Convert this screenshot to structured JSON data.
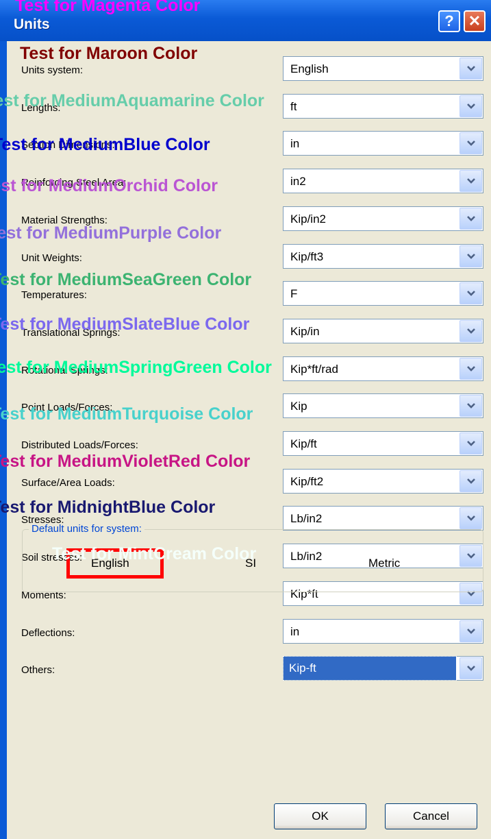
{
  "window": {
    "title": "Units",
    "help_glyph": "?",
    "close_glyph": "✕"
  },
  "rows": [
    {
      "label": "Units system:",
      "value": "English"
    },
    {
      "label": "Lengths:",
      "value": "ft"
    },
    {
      "label": "Section Dimensions:",
      "value": "in"
    },
    {
      "label": "Reinforcing Steel Area:",
      "value": "in2"
    },
    {
      "label": "Material Strengths:",
      "value": "Kip/in2"
    },
    {
      "label": "Unit Weights:",
      "value": "Kip/ft3"
    },
    {
      "label": "Temperatures:",
      "value": "F"
    },
    {
      "label": "Translational Springs:",
      "value": "Kip/in"
    },
    {
      "label": "Rotational Springs:",
      "value": "Kip*ft/rad"
    },
    {
      "label": "Point Loads/Forces:",
      "value": "Kip"
    },
    {
      "label": "Distributed Loads/Forces:",
      "value": "Kip/ft"
    },
    {
      "label": "Surface/Area Loads:",
      "value": "Kip/ft2"
    },
    {
      "label": "Stresses:",
      "value": "Lb/in2"
    },
    {
      "label": "Soil stresses:",
      "value": "Lb/in2"
    },
    {
      "label": "Moments:",
      "value": "Kip*ft"
    },
    {
      "label": "Deflections:",
      "value": "in"
    },
    {
      "label": "Others:",
      "value": "Kip-ft"
    }
  ],
  "defaults": {
    "legend": "Default units for system:",
    "english": "English",
    "si": "SI",
    "metric": "Metric"
  },
  "buttons": {
    "ok": "OK",
    "cancel": "Cancel"
  },
  "overlays": [
    {
      "text": "Test for Magenta Color",
      "color": "#ff00ff"
    },
    {
      "text": "Test for Maroon Color",
      "color": "#800000"
    },
    {
      "text": "Test for MediumAquamarine Color",
      "color": "#66cdaa"
    },
    {
      "text": "Test for MediumBlue Color",
      "color": "#0000cd"
    },
    {
      "text": "Test for MediumOrchid Color",
      "color": "#ba55d3"
    },
    {
      "text": "Test for MediumPurple Color",
      "color": "#9370db"
    },
    {
      "text": "Test for MediumSeaGreen Color",
      "color": "#3cb371"
    },
    {
      "text": "Test for MediumSlateBlue Color",
      "color": "#7b68ee"
    },
    {
      "text": "Test for MediumSpringGreen Color",
      "color": "#00fa9a"
    },
    {
      "text": "Test for MediumTurquoise Color",
      "color": "#48d1cc"
    },
    {
      "text": "Test for MediumVioletRed Color",
      "color": "#c71585"
    },
    {
      "text": "Test for MidnightBlue Color",
      "color": "#191970"
    },
    {
      "text": "Test for MintCream Color",
      "color": "#f5fffa"
    }
  ],
  "colors": {
    "titlebar": "#0a5ad6",
    "client_bg": "#ece9d8",
    "selection": "#316ac5",
    "highlight_box": "#ff0000"
  }
}
